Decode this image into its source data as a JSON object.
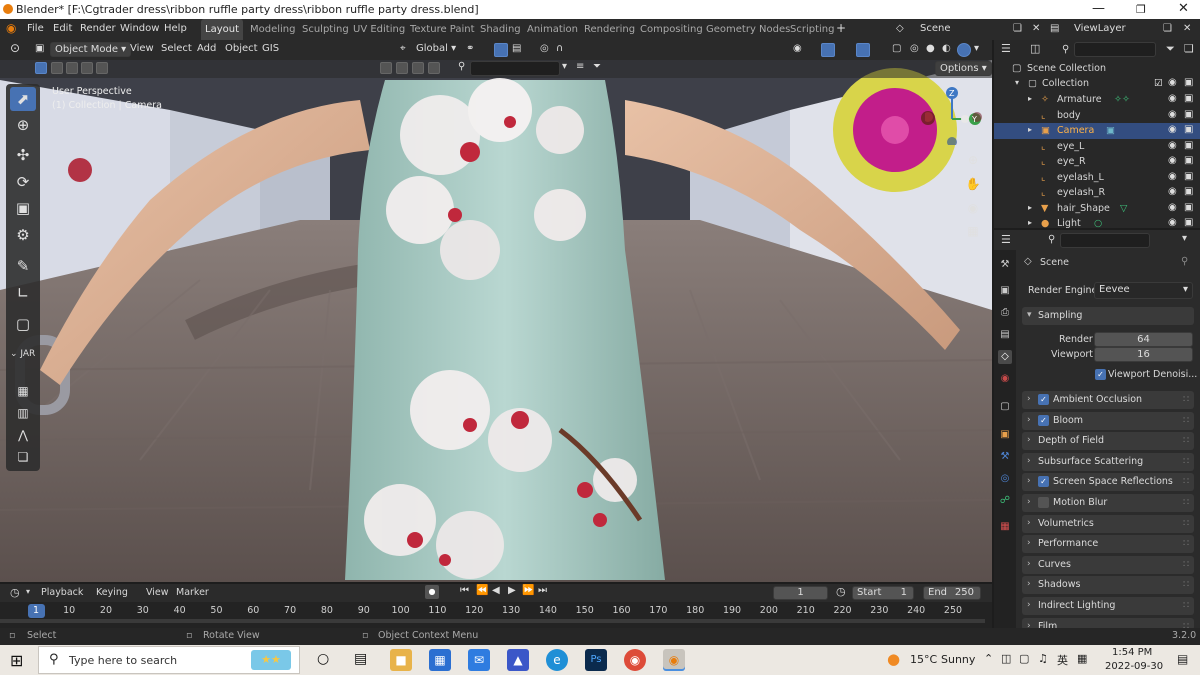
{
  "window": {
    "title": "Blender* [F:\\Cgtrader dress\\ribbon ruffle party dress\\ribbon ruffle party dress.blend]"
  },
  "topbar": {
    "menus": [
      "File",
      "Edit",
      "Render",
      "Window",
      "Help"
    ],
    "workspaces": [
      "Layout",
      "Modeling",
      "Sculpting",
      "UV Editing",
      "Texture Paint",
      "Shading",
      "Animation",
      "Rendering",
      "Compositing",
      "Geometry Nodes",
      "Scripting"
    ],
    "active_workspace": "Layout",
    "add_tab": "+",
    "scene": "Scene",
    "view_layer": "ViewLayer"
  },
  "viewport": {
    "mode": "Object Mode",
    "menus": [
      "View",
      "Select",
      "Add",
      "Object",
      "GIS"
    ],
    "orientation": "Global",
    "options": "Options",
    "perspective_text": "User Perspective",
    "collection_text": "(1) Collection | Camera",
    "gizmo": {
      "x": "X",
      "y": "Y",
      "z": "Z"
    },
    "tool_group_label": "JAR",
    "accent": "#4772b3"
  },
  "outliner": {
    "root": "Scene Collection",
    "collection": "Collection",
    "items": [
      "Armature",
      "body",
      "Camera",
      "eye_L",
      "eye_R",
      "eyelash_L",
      "eyelash_R",
      "hair_Shape",
      "Light"
    ],
    "selected": "Camera"
  },
  "properties": {
    "context": "Scene",
    "render_engine_label": "Render Engine",
    "render_engine": "Eevee",
    "sampling_label": "Sampling",
    "render_label": "Render",
    "render_samples": "64",
    "viewport_label": "Viewport",
    "viewport_samples": "16",
    "viewport_denoise": "Viewport Denoisi...",
    "panels": [
      {
        "label": "Ambient Occlusion",
        "checkbox": true,
        "checked": true
      },
      {
        "label": "Bloom",
        "checkbox": true,
        "checked": true
      },
      {
        "label": "Depth of Field",
        "checkbox": false,
        "checked": false
      },
      {
        "label": "Subsurface Scattering",
        "checkbox": false,
        "checked": false
      },
      {
        "label": "Screen Space Reflections",
        "checkbox": true,
        "checked": true
      },
      {
        "label": "Motion Blur",
        "checkbox": true,
        "checked": false
      },
      {
        "label": "Volumetrics",
        "checkbox": false,
        "checked": false
      },
      {
        "label": "Performance",
        "checkbox": false,
        "checked": false
      },
      {
        "label": "Curves",
        "checkbox": false,
        "checked": false
      },
      {
        "label": "Shadows",
        "checkbox": false,
        "checked": false
      },
      {
        "label": "Indirect Lighting",
        "checkbox": false,
        "checked": false
      },
      {
        "label": "Film",
        "checkbox": false,
        "checked": false
      }
    ]
  },
  "timeline": {
    "menus": [
      "Playback",
      "Keying",
      "View",
      "Marker"
    ],
    "current_frame": "1",
    "start_label": "Start",
    "start": "1",
    "end_label": "End",
    "end": "250",
    "ticks": [
      "1",
      "10",
      "20",
      "30",
      "40",
      "50",
      "60",
      "70",
      "80",
      "90",
      "100",
      "110",
      "120",
      "130",
      "140",
      "150",
      "160",
      "170",
      "180",
      "190",
      "200",
      "210",
      "220",
      "230",
      "240",
      "250"
    ]
  },
  "statusbar": {
    "select": "Select",
    "rotate": "Rotate View",
    "context": "Object Context Menu",
    "version": "3.2.0"
  },
  "taskbar": {
    "search_placeholder": "Type here to search",
    "weather_temp": "15°C",
    "weather_desc": "Sunny",
    "time": "1:54 PM",
    "date": "2022-09-30",
    "ime": "英"
  }
}
